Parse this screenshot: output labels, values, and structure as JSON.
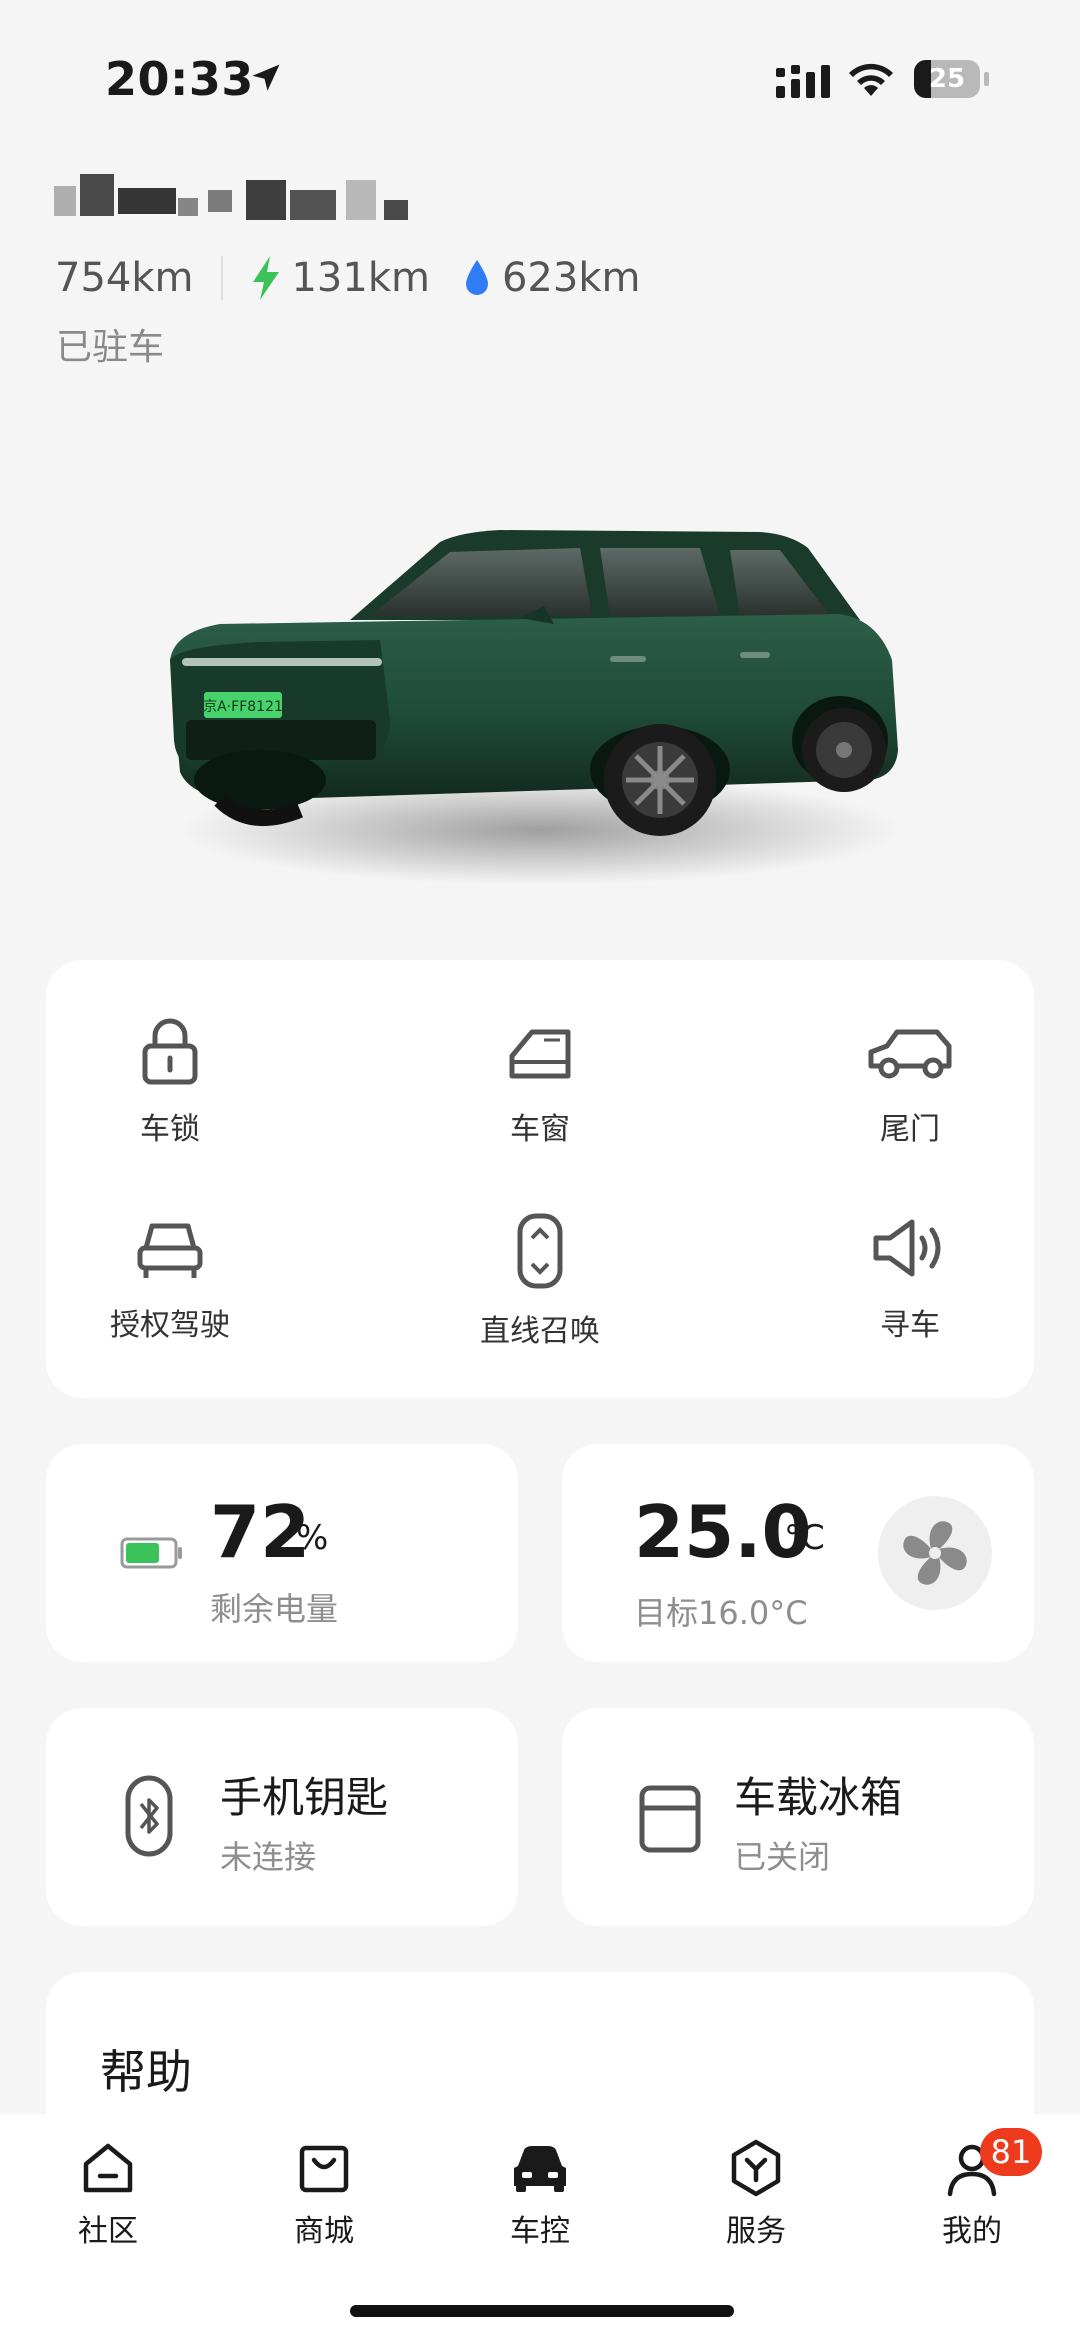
{
  "status_bar": {
    "time": "20:33",
    "battery_percent": "25",
    "battery_level": 0.25
  },
  "vehicle": {
    "range_total": "754km",
    "range_electric": "131km",
    "range_fuel": "623km",
    "status": "已驻车",
    "plate": "京A·FF8121"
  },
  "controls": [
    {
      "label": "车锁",
      "icon": "lock-icon"
    },
    {
      "label": "车窗",
      "icon": "car-window-icon"
    },
    {
      "label": "尾门",
      "icon": "tailgate-icon"
    },
    {
      "label": "授权驾驶",
      "icon": "authorized-drive-icon"
    },
    {
      "label": "直线召唤",
      "icon": "summon-icon"
    },
    {
      "label": "寻车",
      "icon": "find-car-speaker-icon"
    }
  ],
  "battery": {
    "value": "72",
    "unit": "%",
    "label": "剩余电量",
    "level": 0.72,
    "color": "#3cc25a"
  },
  "climate": {
    "temp": "25.0",
    "unit": "°C",
    "target": "目标16.0°C"
  },
  "phone_key": {
    "title": "手机钥匙",
    "status": "未连接"
  },
  "fridge": {
    "title": "车载冰箱",
    "status": "已关闭"
  },
  "help": {
    "title": "帮助"
  },
  "tabs": [
    {
      "label": "社区",
      "icon": "community-icon"
    },
    {
      "label": "商城",
      "icon": "shop-bag-icon"
    },
    {
      "label": "车控",
      "icon": "car-control-icon",
      "active": true
    },
    {
      "label": "服务",
      "icon": "service-icon"
    },
    {
      "label": "我的",
      "icon": "profile-icon",
      "badge": "81"
    }
  ],
  "colors": {
    "accent_green": "#3cc25a",
    "fuel_blue": "#2e7cf6",
    "badge_red": "#ee3b1e",
    "car_green": "#1f4a38"
  }
}
